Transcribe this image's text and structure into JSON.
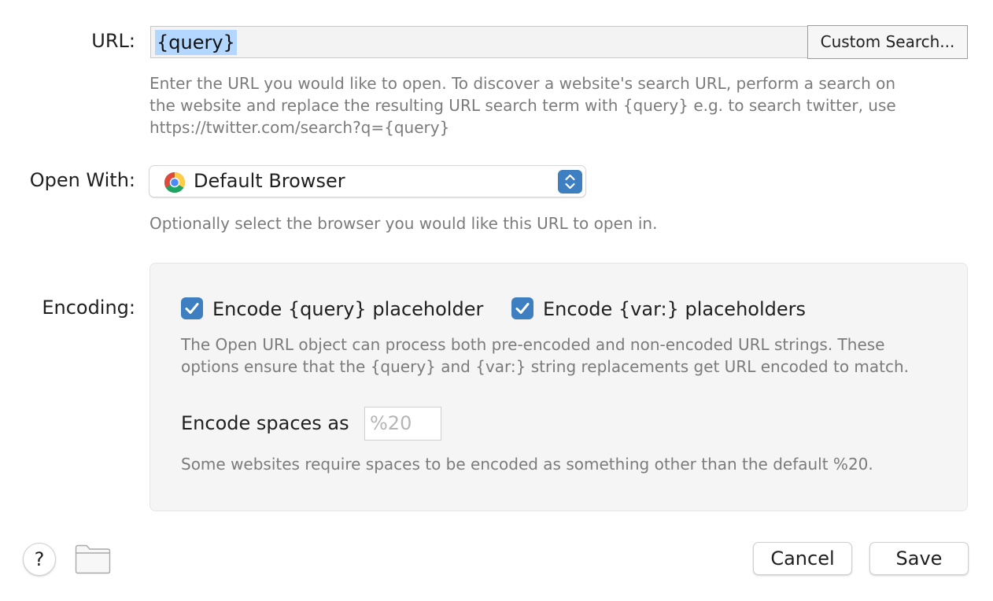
{
  "url": {
    "label": "URL:",
    "value": "{query}",
    "custom_search_label": "Custom Search...",
    "help_lines": [
      "Enter the URL you would like to open. To discover a website's search URL, perform a search on",
      "the website and replace the resulting URL search term with {query} e.g. to search twitter, use",
      "https://twitter.com/search?q={query}"
    ]
  },
  "open_with": {
    "label": "Open With:",
    "selected": "Default Browser",
    "icon": "chrome-icon",
    "help": "Optionally select the browser you would like this URL to open in."
  },
  "encoding": {
    "label": "Encoding:",
    "checkbox_query": {
      "label": "Encode {query} placeholder",
      "checked": true
    },
    "checkbox_var": {
      "label": "Encode {var:} placeholders",
      "checked": true
    },
    "help_lines": [
      "The Open URL object can process both pre-encoded and non-encoded URL strings. These",
      "options ensure that the {query} and {var:} string replacements get URL encoded to match."
    ],
    "spaces_label": "Encode spaces as",
    "spaces_placeholder": "%20",
    "spaces_help": "Some websites require spaces to be encoded as something other than the default %20."
  },
  "footer": {
    "help_label": "?",
    "cancel_label": "Cancel",
    "save_label": "Save"
  },
  "colors": {
    "accent": "#3d7fc1",
    "selection": "#b3d7ff",
    "help_text": "#7b7b7b",
    "panel_bg": "#f5f5f5"
  }
}
